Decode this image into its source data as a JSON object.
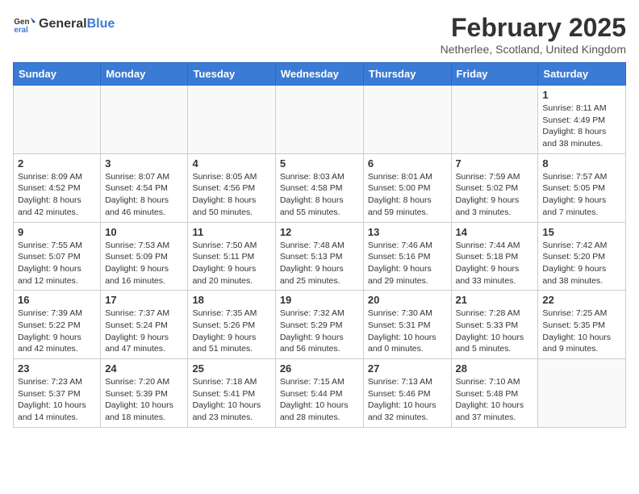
{
  "header": {
    "logo_general": "General",
    "logo_blue": "Blue",
    "title": "February 2025",
    "subtitle": "Netherlee, Scotland, United Kingdom"
  },
  "days_of_week": [
    "Sunday",
    "Monday",
    "Tuesday",
    "Wednesday",
    "Thursday",
    "Friday",
    "Saturday"
  ],
  "weeks": [
    {
      "days": [
        {
          "num": "",
          "info": ""
        },
        {
          "num": "",
          "info": ""
        },
        {
          "num": "",
          "info": ""
        },
        {
          "num": "",
          "info": ""
        },
        {
          "num": "",
          "info": ""
        },
        {
          "num": "",
          "info": ""
        },
        {
          "num": "1",
          "info": "Sunrise: 8:11 AM\nSunset: 4:49 PM\nDaylight: 8 hours and 38 minutes."
        }
      ]
    },
    {
      "days": [
        {
          "num": "2",
          "info": "Sunrise: 8:09 AM\nSunset: 4:52 PM\nDaylight: 8 hours and 42 minutes."
        },
        {
          "num": "3",
          "info": "Sunrise: 8:07 AM\nSunset: 4:54 PM\nDaylight: 8 hours and 46 minutes."
        },
        {
          "num": "4",
          "info": "Sunrise: 8:05 AM\nSunset: 4:56 PM\nDaylight: 8 hours and 50 minutes."
        },
        {
          "num": "5",
          "info": "Sunrise: 8:03 AM\nSunset: 4:58 PM\nDaylight: 8 hours and 55 minutes."
        },
        {
          "num": "6",
          "info": "Sunrise: 8:01 AM\nSunset: 5:00 PM\nDaylight: 8 hours and 59 minutes."
        },
        {
          "num": "7",
          "info": "Sunrise: 7:59 AM\nSunset: 5:02 PM\nDaylight: 9 hours and 3 minutes."
        },
        {
          "num": "8",
          "info": "Sunrise: 7:57 AM\nSunset: 5:05 PM\nDaylight: 9 hours and 7 minutes."
        }
      ]
    },
    {
      "days": [
        {
          "num": "9",
          "info": "Sunrise: 7:55 AM\nSunset: 5:07 PM\nDaylight: 9 hours and 12 minutes."
        },
        {
          "num": "10",
          "info": "Sunrise: 7:53 AM\nSunset: 5:09 PM\nDaylight: 9 hours and 16 minutes."
        },
        {
          "num": "11",
          "info": "Sunrise: 7:50 AM\nSunset: 5:11 PM\nDaylight: 9 hours and 20 minutes."
        },
        {
          "num": "12",
          "info": "Sunrise: 7:48 AM\nSunset: 5:13 PM\nDaylight: 9 hours and 25 minutes."
        },
        {
          "num": "13",
          "info": "Sunrise: 7:46 AM\nSunset: 5:16 PM\nDaylight: 9 hours and 29 minutes."
        },
        {
          "num": "14",
          "info": "Sunrise: 7:44 AM\nSunset: 5:18 PM\nDaylight: 9 hours and 33 minutes."
        },
        {
          "num": "15",
          "info": "Sunrise: 7:42 AM\nSunset: 5:20 PM\nDaylight: 9 hours and 38 minutes."
        }
      ]
    },
    {
      "days": [
        {
          "num": "16",
          "info": "Sunrise: 7:39 AM\nSunset: 5:22 PM\nDaylight: 9 hours and 42 minutes."
        },
        {
          "num": "17",
          "info": "Sunrise: 7:37 AM\nSunset: 5:24 PM\nDaylight: 9 hours and 47 minutes."
        },
        {
          "num": "18",
          "info": "Sunrise: 7:35 AM\nSunset: 5:26 PM\nDaylight: 9 hours and 51 minutes."
        },
        {
          "num": "19",
          "info": "Sunrise: 7:32 AM\nSunset: 5:29 PM\nDaylight: 9 hours and 56 minutes."
        },
        {
          "num": "20",
          "info": "Sunrise: 7:30 AM\nSunset: 5:31 PM\nDaylight: 10 hours and 0 minutes."
        },
        {
          "num": "21",
          "info": "Sunrise: 7:28 AM\nSunset: 5:33 PM\nDaylight: 10 hours and 5 minutes."
        },
        {
          "num": "22",
          "info": "Sunrise: 7:25 AM\nSunset: 5:35 PM\nDaylight: 10 hours and 9 minutes."
        }
      ]
    },
    {
      "days": [
        {
          "num": "23",
          "info": "Sunrise: 7:23 AM\nSunset: 5:37 PM\nDaylight: 10 hours and 14 minutes."
        },
        {
          "num": "24",
          "info": "Sunrise: 7:20 AM\nSunset: 5:39 PM\nDaylight: 10 hours and 18 minutes."
        },
        {
          "num": "25",
          "info": "Sunrise: 7:18 AM\nSunset: 5:41 PM\nDaylight: 10 hours and 23 minutes."
        },
        {
          "num": "26",
          "info": "Sunrise: 7:15 AM\nSunset: 5:44 PM\nDaylight: 10 hours and 28 minutes."
        },
        {
          "num": "27",
          "info": "Sunrise: 7:13 AM\nSunset: 5:46 PM\nDaylight: 10 hours and 32 minutes."
        },
        {
          "num": "28",
          "info": "Sunrise: 7:10 AM\nSunset: 5:48 PM\nDaylight: 10 hours and 37 minutes."
        },
        {
          "num": "",
          "info": ""
        }
      ]
    }
  ]
}
